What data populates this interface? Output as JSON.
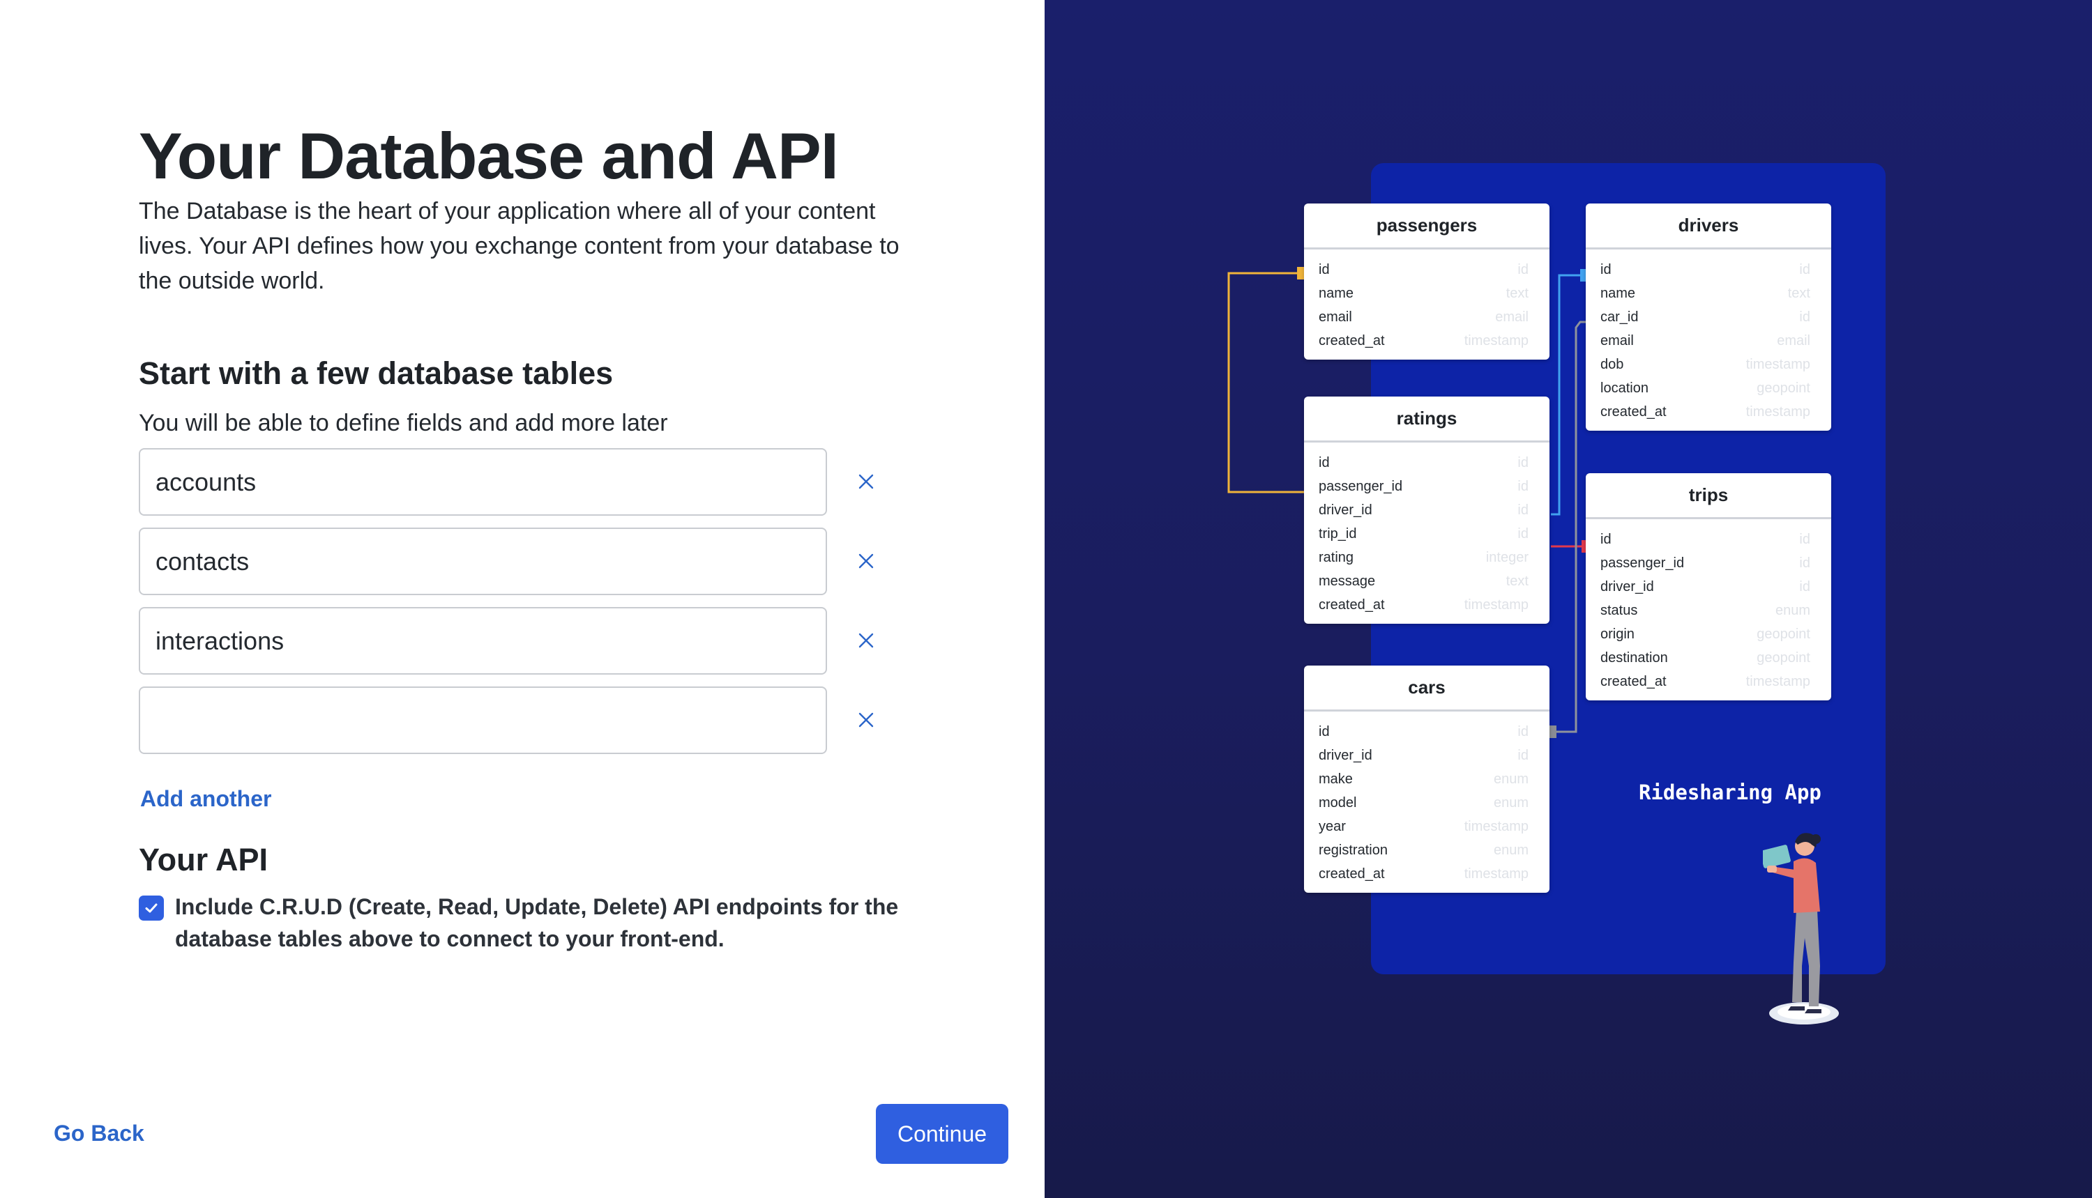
{
  "page": {
    "title": "Your Database and API",
    "intro": "The Database is the heart of your application where all of your content lives. Your API defines how you exchange content from your database to the outside world.",
    "tables_heading": "Start with a few database tables",
    "tables_subtitle": "You will be able to define fields and add more later",
    "table_inputs": [
      {
        "value": "accounts"
      },
      {
        "value": "contacts"
      },
      {
        "value": "interactions"
      },
      {
        "value": ""
      }
    ],
    "remove_icon": "close-icon",
    "add_another": "Add another",
    "api_heading": "Your API",
    "crud_checked": true,
    "crud_label": "Include C.R.U.D (Create, Read, Update, Delete) API endpoints for the database tables above to connect to your front-end.",
    "go_back": "Go Back",
    "continue": "Continue"
  },
  "illustration": {
    "app_name": "Ridesharing App",
    "colors": {
      "board": "#0d23a7",
      "accent_blue": "#2f5fe0",
      "link": "#2b65c9"
    },
    "tables": {
      "passengers": {
        "name": "passengers",
        "fields": [
          {
            "f": "id",
            "t": "id"
          },
          {
            "f": "name",
            "t": "text"
          },
          {
            "f": "email",
            "t": "email"
          },
          {
            "f": "created_at",
            "t": "timestamp"
          }
        ]
      },
      "drivers": {
        "name": "drivers",
        "fields": [
          {
            "f": "id",
            "t": "id"
          },
          {
            "f": "name",
            "t": "text"
          },
          {
            "f": "car_id",
            "t": "id"
          },
          {
            "f": "email",
            "t": "email"
          },
          {
            "f": "dob",
            "t": "timestamp"
          },
          {
            "f": "location",
            "t": "geopoint"
          },
          {
            "f": "created_at",
            "t": "timestamp"
          }
        ]
      },
      "ratings": {
        "name": "ratings",
        "fields": [
          {
            "f": "id",
            "t": "id"
          },
          {
            "f": "passenger_id",
            "t": "id"
          },
          {
            "f": "driver_id",
            "t": "id"
          },
          {
            "f": "trip_id",
            "t": "id"
          },
          {
            "f": "rating",
            "t": "integer"
          },
          {
            "f": "message",
            "t": "text"
          },
          {
            "f": "created_at",
            "t": "timestamp"
          }
        ]
      },
      "trips": {
        "name": "trips",
        "fields": [
          {
            "f": "id",
            "t": "id"
          },
          {
            "f": "passenger_id",
            "t": "id"
          },
          {
            "f": "driver_id",
            "t": "id"
          },
          {
            "f": "status",
            "t": "enum"
          },
          {
            "f": "origin",
            "t": "geopoint"
          },
          {
            "f": "destination",
            "t": "geopoint"
          },
          {
            "f": "created_at",
            "t": "timestamp"
          }
        ]
      },
      "cars": {
        "name": "cars",
        "fields": [
          {
            "f": "id",
            "t": "id"
          },
          {
            "f": "driver_id",
            "t": "id"
          },
          {
            "f": "make",
            "t": "enum"
          },
          {
            "f": "model",
            "t": "enum"
          },
          {
            "f": "year",
            "t": "timestamp"
          },
          {
            "f": "registration",
            "t": "enum"
          },
          {
            "f": "created_at",
            "t": "timestamp"
          }
        ]
      }
    }
  }
}
